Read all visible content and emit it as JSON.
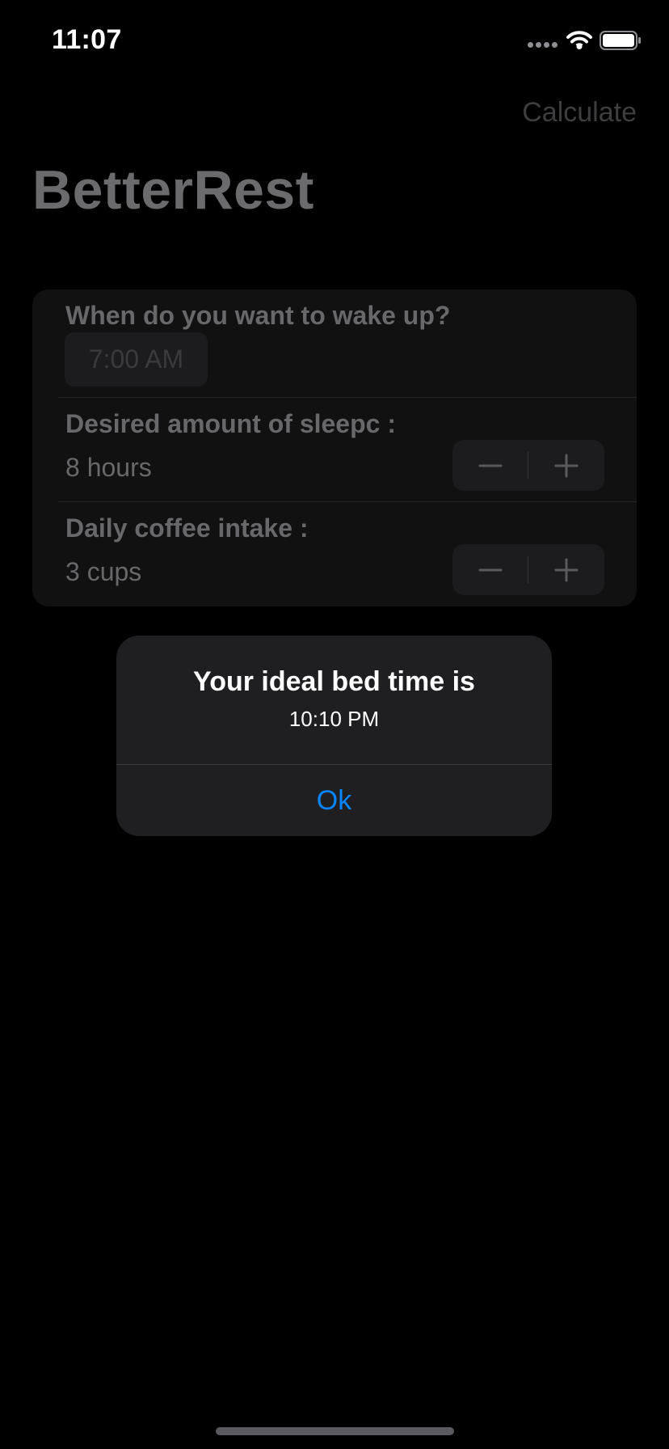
{
  "status_bar": {
    "time": "11:07",
    "signal_icon": "signal-dots-icon",
    "wifi_icon": "wifi-icon",
    "battery_icon": "battery-full-icon"
  },
  "nav": {
    "action_label": "Calculate",
    "title": "BetterRest"
  },
  "form": {
    "wake": {
      "label": "When do you want to wake up?",
      "value": "7:00 AM"
    },
    "sleep": {
      "label": "Desired amount of sleepc :",
      "value": "8 hours",
      "decrement_icon": "minus-icon",
      "increment_icon": "plus-icon"
    },
    "coffee": {
      "label": "Daily coffee intake :",
      "value": "3 cups",
      "decrement_icon": "minus-icon",
      "increment_icon": "plus-icon"
    }
  },
  "alert": {
    "title": "Your ideal bed time is",
    "message": "10:10 PM",
    "button_label": "Ok"
  },
  "colors": {
    "background": "#000000",
    "accent": "#0a84ff",
    "card": "#111112",
    "alert": "#1f1f21"
  }
}
